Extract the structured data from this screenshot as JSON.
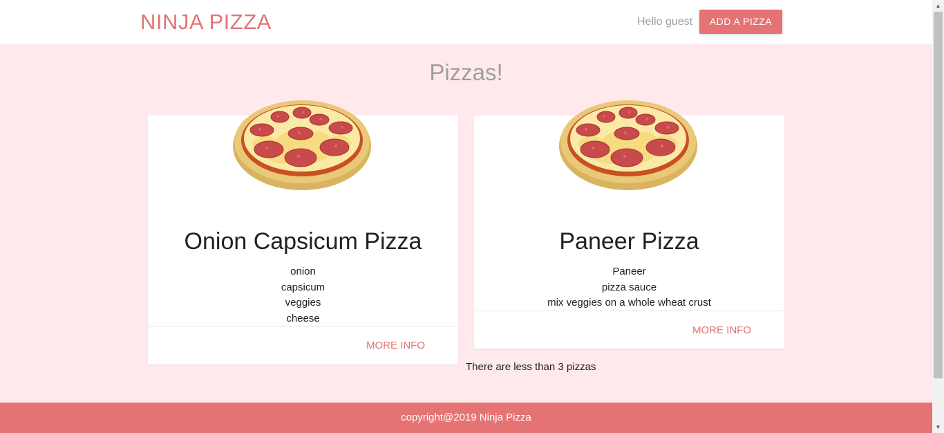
{
  "nav": {
    "brand": "NINJA PIZZA",
    "greeting": "Hello guest",
    "add_button": "ADD A PIZZA"
  },
  "main": {
    "title": "Pizzas!",
    "pizzas": [
      {
        "title": "Onion Capsicum Pizza",
        "ingredients": [
          "onion",
          "capsicum",
          "veggies",
          "cheese"
        ],
        "more_info": "MORE INFO",
        "image_icon": "pizza-icon"
      },
      {
        "title": "Paneer Pizza",
        "ingredients": [
          "Paneer",
          "pizza sauce",
          "mix veggies on a whole wheat crust"
        ],
        "more_info": "MORE INFO",
        "image_icon": "pizza-icon"
      }
    ],
    "count_message": "There are less than 3 pizzas"
  },
  "footer": {
    "text": "copyright@2019 Ninja Pizza"
  },
  "colors": {
    "accent": "#e57373",
    "background": "#ffe9ec",
    "muted_text": "#9e9e9e"
  }
}
